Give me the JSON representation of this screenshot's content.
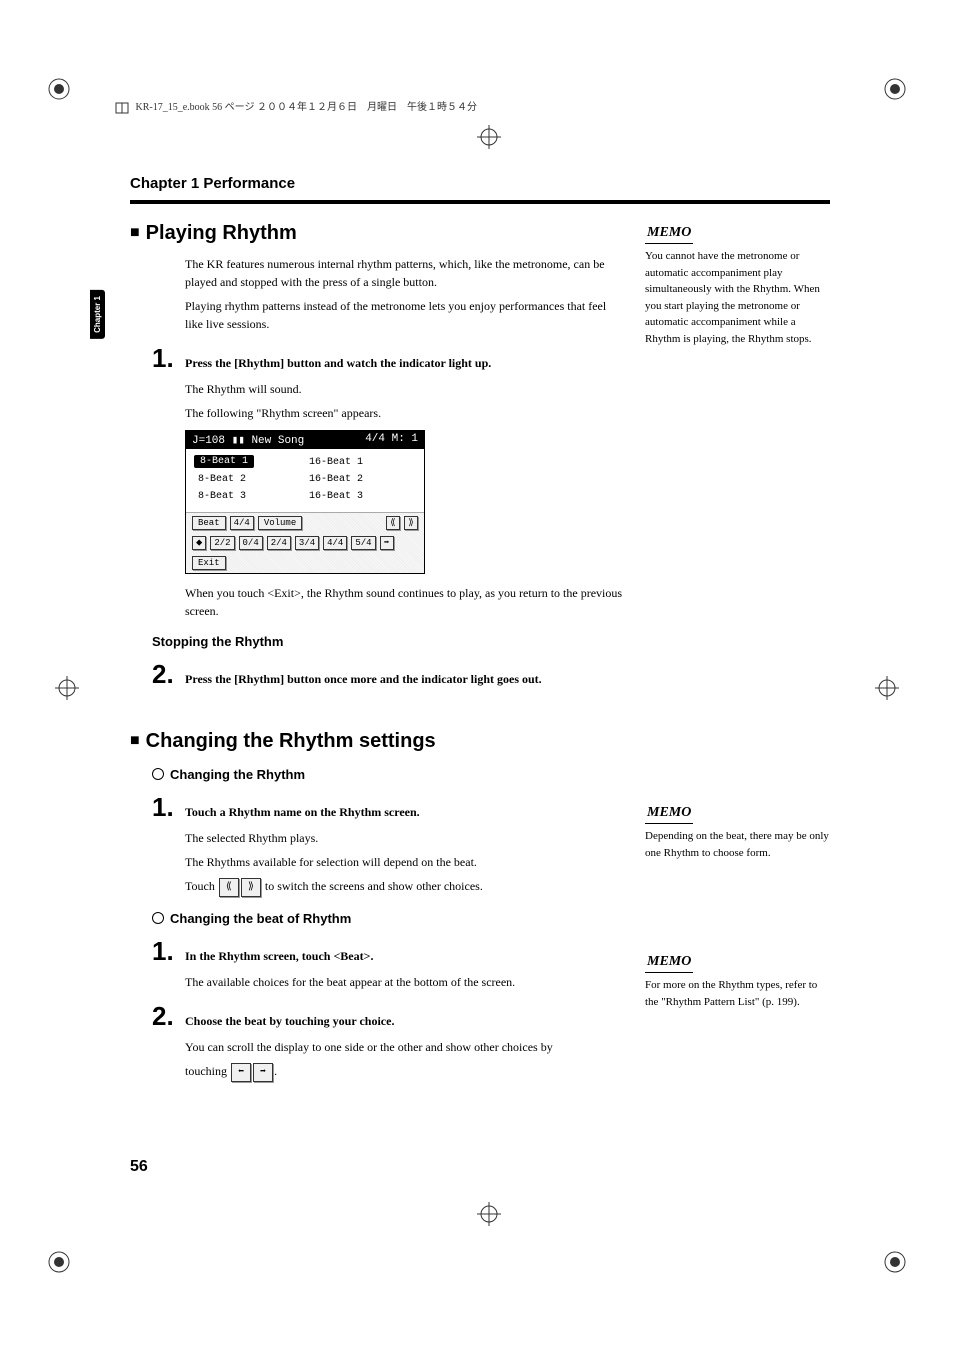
{
  "header_line": "KR-17_15_e.book  56 ページ  ２００４年１２月６日　月曜日　午後１時５４分",
  "side_tab": "Chapter 1",
  "chapter_title": "Chapter 1 Performance",
  "page_number": "56",
  "section1": {
    "title": "Playing Rhythm",
    "p1": "The KR features numerous internal rhythm patterns, which, like the metronome, can be played and stopped with the press of a single button.",
    "p2": "Playing rhythm patterns instead of the metronome lets you enjoy performances that feel like live sessions.",
    "step1": "Press the [Rhythm] button and watch the indicator light up.",
    "step1_note1": "The Rhythm will sound.",
    "step1_note2": "The following \"Rhythm screen\" appears.",
    "after_screen": "When you touch <Exit>, the Rhythm sound continues to play, as you return to the previous screen.",
    "stopping_title": "Stopping the Rhythm",
    "step2": "Press the [Rhythm] button once more and the indicator light goes out."
  },
  "screen": {
    "header_left": "J=108 ▮▮ New Song",
    "header_right": "4/4  M:   1",
    "left_col": [
      "8-Beat 1",
      "8-Beat 2",
      "8-Beat 3"
    ],
    "right_col": [
      "16-Beat 1",
      "16-Beat 2",
      "16-Beat 3"
    ],
    "row1": {
      "beat": "Beat",
      "beat_val": "4/4",
      "volume": "Volume",
      "prev": "⟪",
      "next": "⟫"
    },
    "row2": [
      "⬥",
      "2/2",
      "0/4",
      "2/4",
      "3/4",
      "4/4",
      "5/4",
      "➡"
    ],
    "exit": "Exit"
  },
  "section2": {
    "title": "Changing the Rhythm settings",
    "sub1_title": "Changing the Rhythm",
    "sub1_step1": "Touch a Rhythm name on the Rhythm screen.",
    "sub1_note1": "The selected Rhythm plays.",
    "sub1_note2": "The Rhythms available for selection will depend on the beat.",
    "sub1_touch_pre": "Touch ",
    "sub1_touch_post": " to switch the screens and show other choices.",
    "sub2_title": "Changing the beat of Rhythm",
    "sub2_step1": "In the Rhythm screen, touch <Beat>.",
    "sub2_note1": "The available choices for the beat appear at the bottom of the screen.",
    "sub2_step2": "Choose the beat by touching your choice.",
    "sub2_note2_pre": "You can scroll the display to one side or the other and show other choices by",
    "sub2_note2_touching": "touching ",
    "sub2_note2_post": "."
  },
  "memo": {
    "label": "MEMO",
    "m1": "You cannot have the metronome or automatic accompaniment play simultaneously with the Rhythm. When you start playing the metronome or automatic accompaniment while a Rhythm is playing, the Rhythm stops.",
    "m2": "Depending on the beat, there may be only one Rhythm to choose form.",
    "m3": "For more on the Rhythm types, refer to the \"Rhythm Pattern List\" (p. 199)."
  },
  "inline_icons": {
    "prev": "⟪",
    "next": "⟫",
    "left": "⬅",
    "right": "➡"
  }
}
